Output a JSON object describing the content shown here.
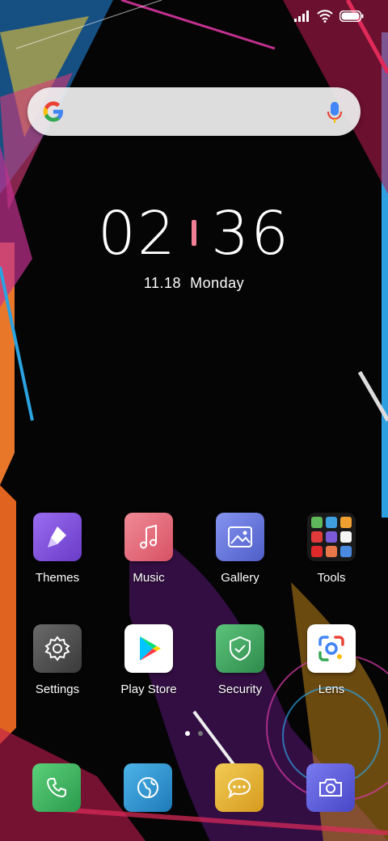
{
  "status_bar": {
    "signal_icon": "signal-icon",
    "wifi_icon": "wifi-icon",
    "battery_icon": "battery-icon"
  },
  "search_bar": {
    "logo_icon": "google-g-icon",
    "mic_icon": "mic-icon"
  },
  "clock": {
    "hours": "02",
    "minutes": "36",
    "date": "11.18",
    "weekday": "Monday"
  },
  "apps": [
    {
      "label": "Themes",
      "icon": "themes-icon",
      "color": "#7b4fd6"
    },
    {
      "label": "Music",
      "icon": "music-icon",
      "color": "#e06a7a"
    },
    {
      "label": "Gallery",
      "icon": "gallery-icon",
      "color": "#5f6fd8"
    },
    {
      "label": "Tools",
      "icon": "folder-icon",
      "color": "#1b1b1b"
    },
    {
      "label": "Settings",
      "icon": "gear-icon",
      "color": "#555555"
    },
    {
      "label": "Play Store",
      "icon": "play-store-icon",
      "color": "#ffffff"
    },
    {
      "label": "Security",
      "icon": "shield-icon",
      "color": "#3a9e58"
    },
    {
      "label": "Lens",
      "icon": "lens-icon",
      "color": "#ffffff"
    }
  ],
  "dock": [
    {
      "icon": "phone-icon",
      "color": "#3cae5a"
    },
    {
      "icon": "browser-icon",
      "color": "#2f8fc9"
    },
    {
      "icon": "messages-icon",
      "color": "#e2b13a"
    },
    {
      "icon": "camera-icon",
      "color": "#5a5ad8"
    }
  ],
  "page_indicator": {
    "pages": 2,
    "current": 1
  }
}
